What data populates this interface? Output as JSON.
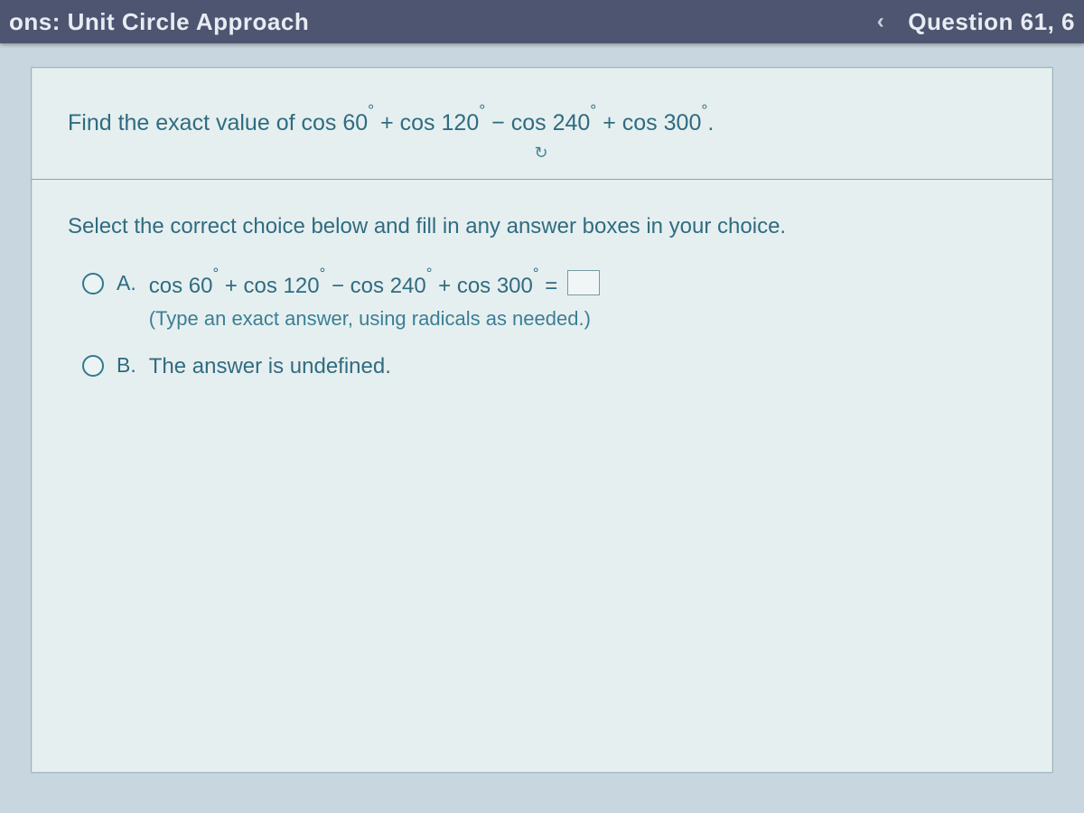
{
  "header": {
    "title": "ons: Unit Circle Approach",
    "question_indicator": "Question 61, 6"
  },
  "question": {
    "text_prefix": "Find the exact value of ",
    "expr_part1": "cos 60",
    "deg": "°",
    "plus": " + ",
    "expr_part2": "cos 120",
    "minus": " − ",
    "expr_part3": "cos 240",
    "expr_part4": "cos 300",
    "period": "."
  },
  "refresh_label": "↻",
  "instruction": "Select the correct choice below and fill in any answer boxes in your choice.",
  "choices": {
    "A": {
      "letter": "A.",
      "expr_prefix": "",
      "c1": "cos 60",
      "c2": "cos 120",
      "c3": "cos 240",
      "c4": "cos 300",
      "equals": " = ",
      "hint": "(Type an exact answer, using radicals as needed.)"
    },
    "B": {
      "letter": "B.",
      "text": "The answer is undefined."
    }
  }
}
